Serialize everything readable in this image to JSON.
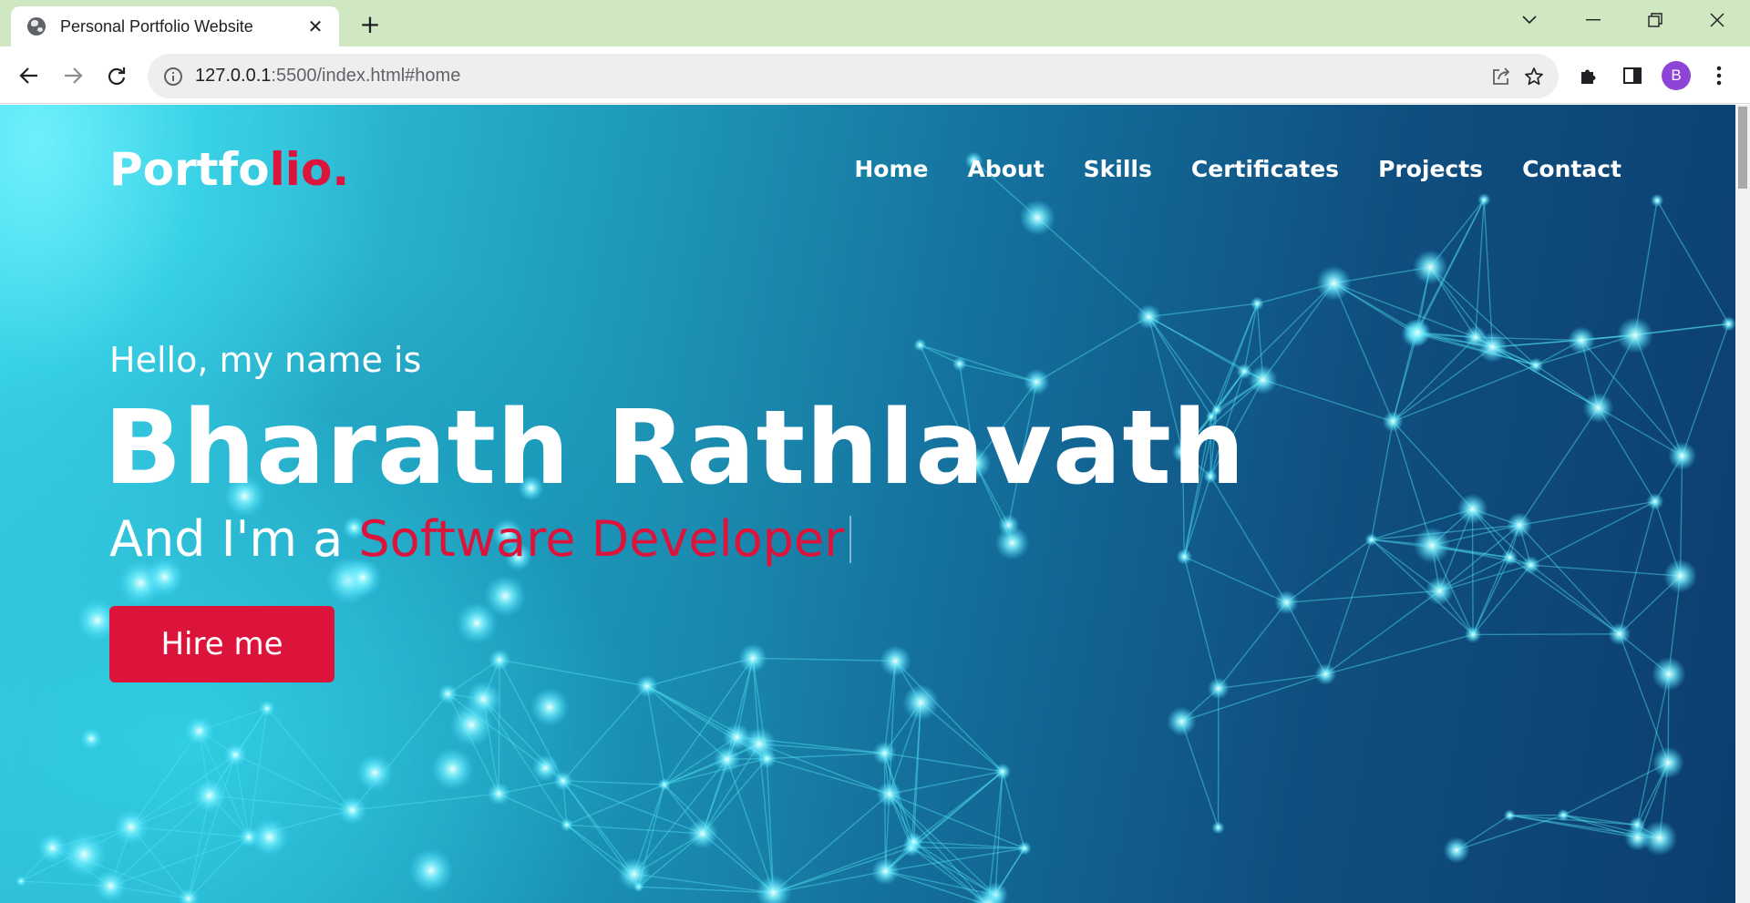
{
  "browser": {
    "tab_title": "Personal Portfolio Website",
    "url_host": "127.0.0.1",
    "url_rest": ":5500/index.html#home",
    "profile_initial": "B",
    "icons": [
      "globe-icon",
      "close-icon",
      "plus-icon",
      "chevron-down-icon",
      "minimize-icon",
      "restore-icon",
      "window-close-icon",
      "back-arrow-icon",
      "forward-arrow-icon",
      "reload-icon",
      "info-icon",
      "share-icon",
      "star-icon",
      "puzzle-icon",
      "side-panel-icon",
      "more-vert-icon"
    ]
  },
  "site": {
    "logo_main": "Portfo",
    "logo_accent": "lio.",
    "nav": [
      "Home",
      "About",
      "Skills",
      "Certificates",
      "Projects",
      "Contact"
    ],
    "hello": "Hello, my name is",
    "name": "Bharath Rathlavath",
    "role_prefix": "And I'm a ",
    "role_typed": "Software Developer",
    "cta": "Hire me"
  },
  "colors": {
    "accent": "#dc143c",
    "titlebar": "#cfe8c2",
    "avatar": "#8e44d6"
  }
}
